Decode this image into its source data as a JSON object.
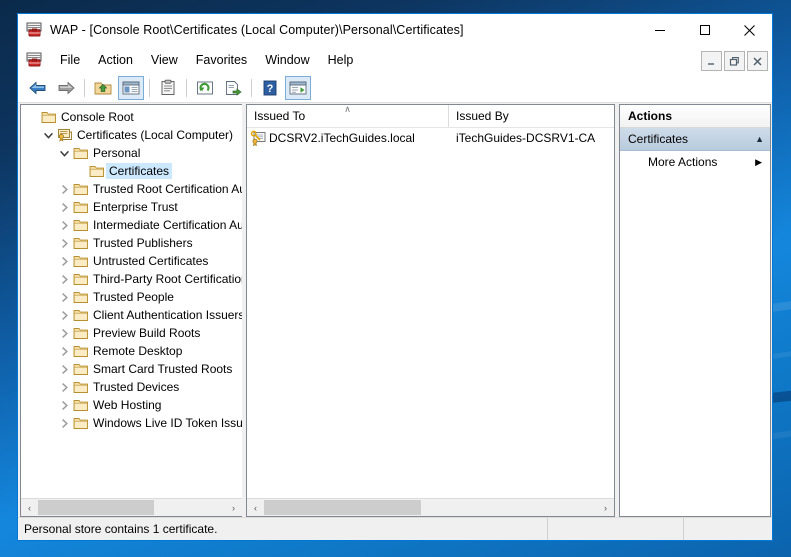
{
  "window": {
    "title": "WAP - [Console Root\\Certificates (Local Computer)\\Personal\\Certificates]",
    "app_icon": "mmc-console-icon",
    "controls": {
      "minimize": "—",
      "maximize": "☐",
      "close": "✕"
    },
    "mdi_controls": {
      "minimize": "–",
      "restore": "❐",
      "close": "✖"
    }
  },
  "menu": {
    "items": [
      {
        "label": "File"
      },
      {
        "label": "Action"
      },
      {
        "label": "View"
      },
      {
        "label": "Favorites"
      },
      {
        "label": "Window"
      },
      {
        "label": "Help"
      }
    ]
  },
  "toolbar": {
    "buttons": [
      {
        "name": "back-button",
        "icon": "left-arrow-icon",
        "pressed": false
      },
      {
        "name": "forward-button",
        "icon": "right-arrow-icon",
        "pressed": false
      },
      {
        "name": "up-one-level-button",
        "icon": "folder-up-icon",
        "pressed": false
      },
      {
        "name": "show-hide-console-tree-button",
        "icon": "console-tree-icon",
        "pressed": true
      },
      {
        "name": "properties-button",
        "icon": "clipboard-icon",
        "pressed": false
      },
      {
        "name": "refresh-button",
        "icon": "refresh-icon",
        "pressed": false
      },
      {
        "name": "export-list-button",
        "icon": "export-list-icon",
        "pressed": false
      },
      {
        "name": "help-button",
        "icon": "question-mark-icon",
        "pressed": false
      },
      {
        "name": "show-hide-action-pane-button",
        "icon": "action-pane-icon",
        "pressed": true
      }
    ]
  },
  "tree": {
    "items": [
      {
        "label": "Console Root",
        "indent": 0,
        "twisty": "none",
        "icon": "folder-icon",
        "selected": false
      },
      {
        "label": "Certificates (Local Computer)",
        "indent": 1,
        "twisty": "expanded",
        "icon": "certificates-snapin-icon",
        "selected": false
      },
      {
        "label": "Personal",
        "indent": 2,
        "twisty": "expanded",
        "icon": "folder-icon",
        "selected": false
      },
      {
        "label": "Certificates",
        "indent": 3,
        "twisty": "none",
        "icon": "folder-icon",
        "selected": true
      },
      {
        "label": "Trusted Root Certification Au",
        "indent": 2,
        "twisty": "collapsed",
        "icon": "folder-icon",
        "selected": false
      },
      {
        "label": "Enterprise Trust",
        "indent": 2,
        "twisty": "collapsed",
        "icon": "folder-icon",
        "selected": false
      },
      {
        "label": "Intermediate Certification Au",
        "indent": 2,
        "twisty": "collapsed",
        "icon": "folder-icon",
        "selected": false
      },
      {
        "label": "Trusted Publishers",
        "indent": 2,
        "twisty": "collapsed",
        "icon": "folder-icon",
        "selected": false
      },
      {
        "label": "Untrusted Certificates",
        "indent": 2,
        "twisty": "collapsed",
        "icon": "folder-icon",
        "selected": false
      },
      {
        "label": "Third-Party Root Certification",
        "indent": 2,
        "twisty": "collapsed",
        "icon": "folder-icon",
        "selected": false
      },
      {
        "label": "Trusted People",
        "indent": 2,
        "twisty": "collapsed",
        "icon": "folder-icon",
        "selected": false
      },
      {
        "label": "Client Authentication Issuers",
        "indent": 2,
        "twisty": "collapsed",
        "icon": "folder-icon",
        "selected": false
      },
      {
        "label": "Preview Build Roots",
        "indent": 2,
        "twisty": "collapsed",
        "icon": "folder-icon",
        "selected": false
      },
      {
        "label": "Remote Desktop",
        "indent": 2,
        "twisty": "collapsed",
        "icon": "folder-icon",
        "selected": false
      },
      {
        "label": "Smart Card Trusted Roots",
        "indent": 2,
        "twisty": "collapsed",
        "icon": "folder-icon",
        "selected": false
      },
      {
        "label": "Trusted Devices",
        "indent": 2,
        "twisty": "collapsed",
        "icon": "folder-icon",
        "selected": false
      },
      {
        "label": "Web Hosting",
        "indent": 2,
        "twisty": "collapsed",
        "icon": "folder-icon",
        "selected": false
      },
      {
        "label": "Windows Live ID Token Issue",
        "indent": 2,
        "twisty": "collapsed",
        "icon": "folder-icon",
        "selected": false
      }
    ],
    "scrollbar": {
      "left_arrow": "‹",
      "right_arrow": "›",
      "thumb_percent": 62
    }
  },
  "list": {
    "columns": [
      {
        "label": "Issued To",
        "sorted": "ascending",
        "sort_glyph": "∧"
      },
      {
        "label": "Issued By",
        "sorted": "none",
        "sort_glyph": ""
      }
    ],
    "rows": [
      {
        "icon": "certificate-with-key-icon",
        "issued_to": "DCSRV2.iTechGuides.local",
        "issued_by": "iTechGuides-DCSRV1-CA"
      }
    ],
    "scrollbar": {
      "left_arrow": "‹",
      "right_arrow": "›",
      "thumb_percent": 47
    }
  },
  "actions": {
    "title": "Actions",
    "groups": [
      {
        "label": "Certificates",
        "chevron": "▲",
        "items": [
          {
            "label": "More Actions",
            "arrow": "▶"
          }
        ]
      }
    ]
  },
  "status": {
    "text": "Personal store contains 1 certificate."
  },
  "colors": {
    "accent": "#0078d7",
    "selection": "#cce8ff",
    "actions_header": "#b8cbde",
    "window_border": "#0078d7",
    "pane_border": "#828790"
  }
}
